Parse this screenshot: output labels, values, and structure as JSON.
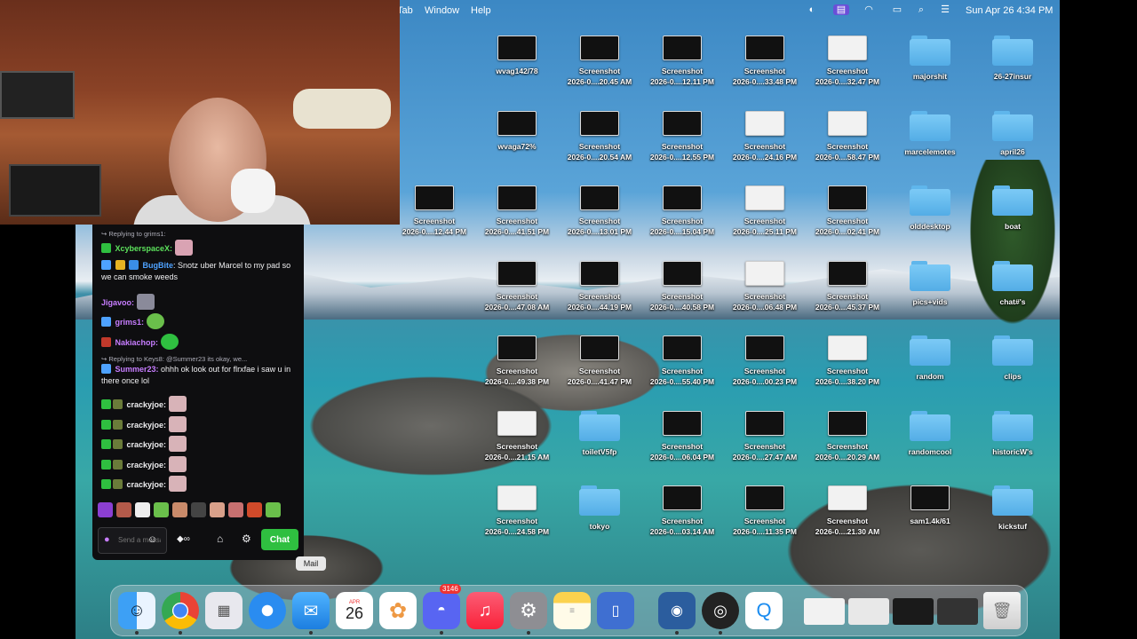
{
  "menubar": {
    "items": [
      "Tab",
      "Window",
      "Help"
    ],
    "datetime": "Sun Apr 26  4:34 PM"
  },
  "desktop": {
    "icons": [
      {
        "label": "wvag142/78",
        "kind": "thumb"
      },
      {
        "label": "Screenshot\n2026-0....20.45 AM",
        "kind": "thumb"
      },
      {
        "label": "Screenshot\n2026-0....12.11 PM",
        "kind": "thumb"
      },
      {
        "label": "Screenshot\n2026-0....33.48 PM",
        "kind": "thumb"
      },
      {
        "label": "Screenshot\n2026-0....32.47 PM",
        "kind": "thumb-light"
      },
      {
        "label": "majorshit",
        "kind": "folder"
      },
      {
        "label": "26-27insur",
        "kind": "folder"
      },
      {
        "label": "wvaga72%",
        "kind": "thumb"
      },
      {
        "label": "Screenshot\n2026-0....20.54 AM",
        "kind": "thumb"
      },
      {
        "label": "Screenshot\n2026-0....12.55 PM",
        "kind": "thumb"
      },
      {
        "label": "Screenshot\n2026-0....24.16 PM",
        "kind": "thumb-light"
      },
      {
        "label": "Screenshot\n2026-0....58.47 PM",
        "kind": "thumb-light"
      },
      {
        "label": "marcelemotes",
        "kind": "folder"
      },
      {
        "label": "april26",
        "kind": "folder"
      },
      {
        "label": "Screenshot\n2026-0....12.44 PM",
        "kind": "thumb"
      },
      {
        "label": "Screenshot\n2026-0....41.51 PM",
        "kind": "thumb"
      },
      {
        "label": "Screenshot\n2026-0....13.01 PM",
        "kind": "thumb"
      },
      {
        "label": "Screenshot\n2026-0....15.04 PM",
        "kind": "thumb"
      },
      {
        "label": "Screenshot\n2026-0....25.11 PM",
        "kind": "thumb-light"
      },
      {
        "label": "Screenshot\n2026-0....02.41 PM",
        "kind": "thumb"
      },
      {
        "label": "olddesktop",
        "kind": "folder"
      },
      {
        "label": "boat",
        "kind": "folder"
      },
      {
        "label": "Screenshot\n2026-0....47.08 AM",
        "kind": "thumb"
      },
      {
        "label": "Screenshot\n2026-0....44.19 PM",
        "kind": "thumb"
      },
      {
        "label": "Screenshot\n2026-0....40.58 PM",
        "kind": "thumb"
      },
      {
        "label": "Screenshot\n2026-0....06.48 PM",
        "kind": "thumb-light"
      },
      {
        "label": "Screenshot\n2026-0....45.37 PM",
        "kind": "thumb"
      },
      {
        "label": "pics+vids",
        "kind": "folder"
      },
      {
        "label": "chat#'s",
        "kind": "folder"
      },
      {
        "label": "Screenshot\n2026-0....49.38 PM",
        "kind": "thumb"
      },
      {
        "label": "Screenshot\n2026-0....41.47 PM",
        "kind": "thumb"
      },
      {
        "label": "Screenshot\n2026-0....55.40 PM",
        "kind": "thumb"
      },
      {
        "label": "Screenshot\n2026-0....00.23 PM",
        "kind": "thumb"
      },
      {
        "label": "Screenshot\n2026-0....38.20 PM",
        "kind": "thumb-light"
      },
      {
        "label": "random",
        "kind": "folder"
      },
      {
        "label": "clips",
        "kind": "folder"
      },
      {
        "label": "Screenshot\n2026-0....21.15 AM",
        "kind": "thumb-light"
      },
      {
        "label": "toiletV5fp",
        "kind": "folder"
      },
      {
        "label": "Screenshot\n2026-0....06.04 PM",
        "kind": "thumb"
      },
      {
        "label": "Screenshot\n2026-0....27.47 AM",
        "kind": "thumb"
      },
      {
        "label": "Screenshot\n2026-0....20.29 AM",
        "kind": "thumb"
      },
      {
        "label": "randomcool",
        "kind": "folder"
      },
      {
        "label": "historicW's",
        "kind": "folder"
      },
      {
        "label": "Screenshot\n2026-0....24.58 PM",
        "kind": "thumb-light"
      },
      {
        "label": "tokyo",
        "kind": "folder"
      },
      {
        "label": "Screenshot\n2026-0....03.14 AM",
        "kind": "thumb"
      },
      {
        "label": "Screenshot\n2026-0....11.35 PM",
        "kind": "thumb"
      },
      {
        "label": "Screenshot\n2026-0....21.30 AM",
        "kind": "thumb-light"
      },
      {
        "label": "sam1.4k/61",
        "kind": "thumb"
      },
      {
        "label": "kickstuf",
        "kind": "folder"
      }
    ]
  },
  "chat": {
    "reply1": "Replying to grims1:",
    "m1_user": "XcyberspaceX:",
    "m2_user": "BugBite",
    "m2_text": ": Snotz uber Marcel to my pad so we can smoke weeds",
    "m3_user": "Jigavoo:",
    "m4_user": "grims1:",
    "m5_user": "Nakiachop:",
    "reply2": "Replying to Keys8: @Summer23 its okay, we...",
    "m6_user": "Summer23:",
    "m6_text": " ohhh ok look out for flrxfae i saw u in there once lol",
    "spam_user": "crackyjoe:",
    "input_placeholder": "Send a message",
    "send_label": "Chat"
  },
  "dock": {
    "tooltip": "Mail",
    "calendar_day": "26",
    "discord_badge": "3146"
  },
  "colors": {
    "twitch_green": "#2fbf40",
    "folder_blue": "#5fb6ec",
    "user_green": "#5ce25c",
    "user_blue": "#4ea2ff",
    "user_purple": "#c77dff"
  }
}
